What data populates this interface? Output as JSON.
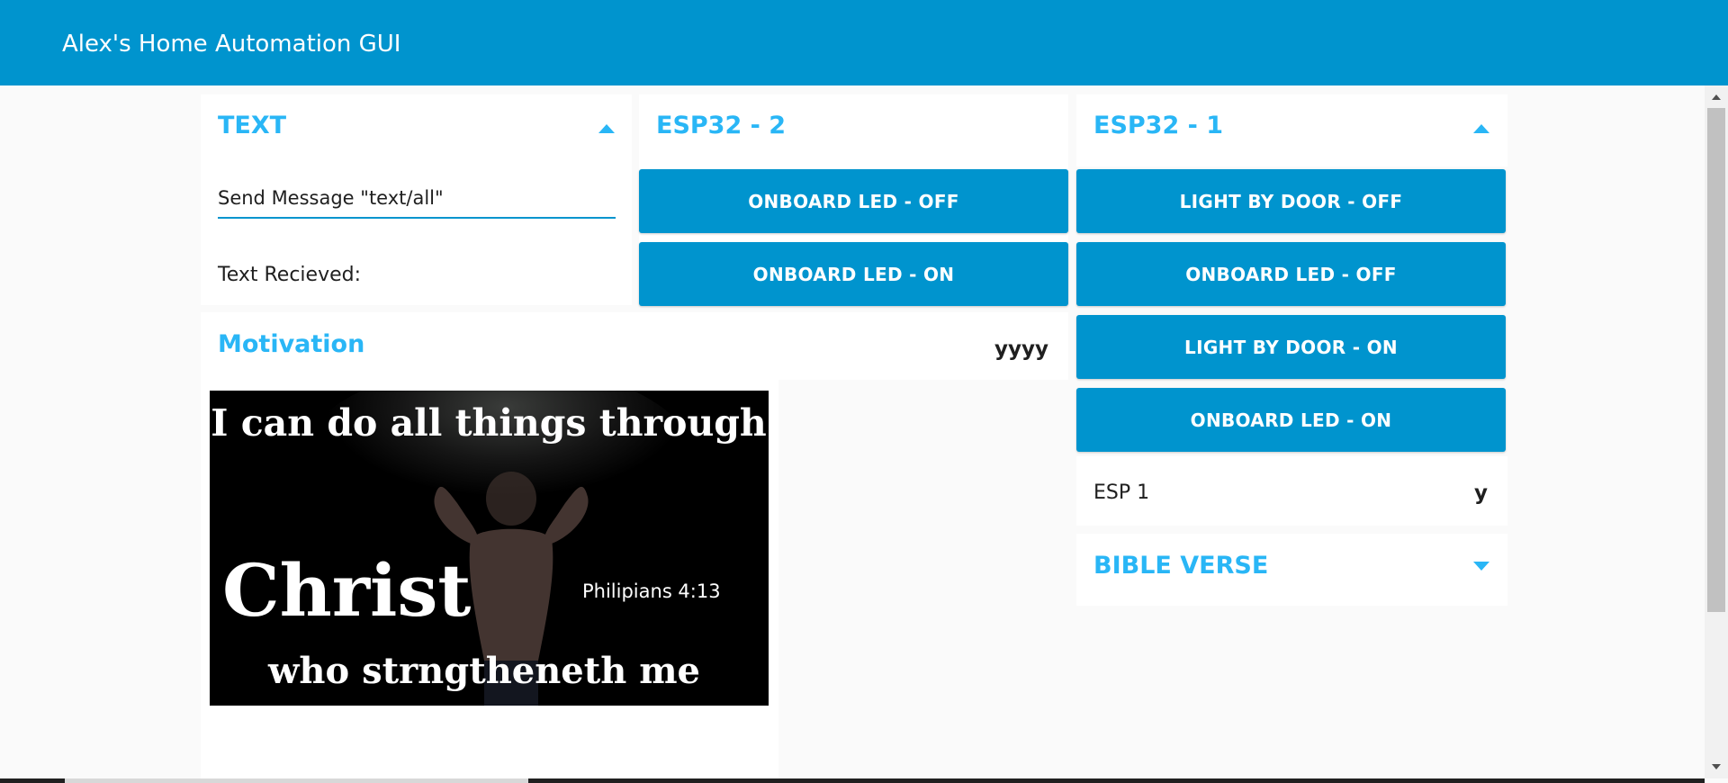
{
  "app": {
    "title": "Alex's Home Automation GUI"
  },
  "colors": {
    "header": "#0094ce",
    "accent": "#29b6f6",
    "button": "#0094ce"
  },
  "text_card": {
    "title": "TEXT",
    "input_value": "Send Message \"text/all\"",
    "received_label": "Text Recieved:",
    "received_value": ""
  },
  "esp32_2": {
    "title": "ESP32 - 2",
    "buttons": [
      "ONBOARD LED - OFF",
      "ONBOARD LED - ON"
    ]
  },
  "motivation": {
    "title": "Motivation",
    "value": "yyyy",
    "image": {
      "line1": "I can do all things through",
      "line2": "Christ",
      "line3": "who strngtheneth me",
      "reference": "Philipians 4:13"
    }
  },
  "esp32_1": {
    "title": "ESP32 - 1",
    "buttons": [
      "LIGHT BY DOOR - OFF",
      "ONBOARD LED - OFF",
      "LIGHT BY DOOR - ON",
      "ONBOARD LED - ON"
    ],
    "status_label": "ESP 1",
    "status_value": "y"
  },
  "bible_verse": {
    "title": "BIBLE VERSE"
  },
  "icons": {
    "text_collapse": "caret-up-icon",
    "esp32_1_collapse": "caret-up-icon",
    "bible_expand": "caret-down-icon"
  }
}
